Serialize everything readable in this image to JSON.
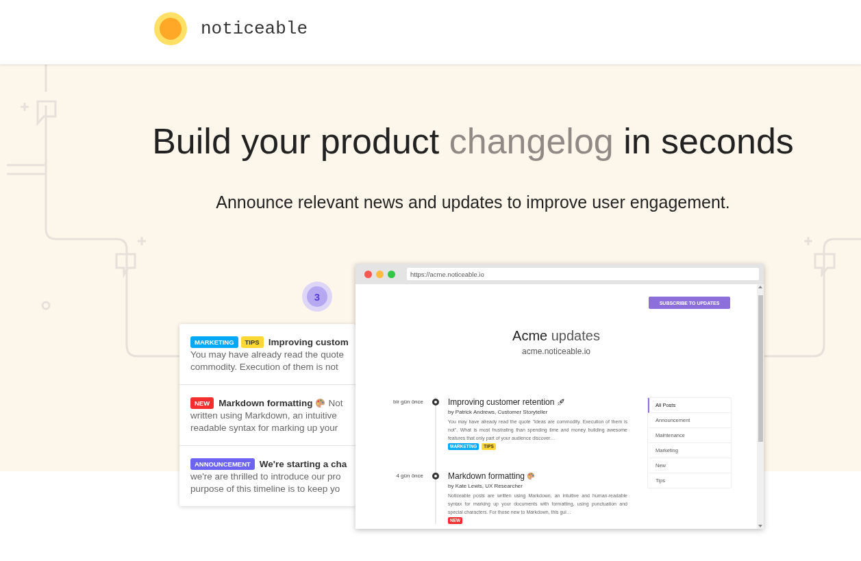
{
  "header": {
    "logo_text": "noticeable"
  },
  "hero": {
    "title_before": "Build your product",
    "title_highlight": "changelog",
    "title_after": "in seconds",
    "subtitle": "Announce relevant news and updates to improve user engagement."
  },
  "widget": {
    "badge_count": "3",
    "items": [
      {
        "tags": [
          {
            "label": "MARKETING",
            "color": "#03a9f4"
          },
          {
            "label": "TIPS",
            "color": "#fdd835"
          }
        ],
        "title": "Improving custom",
        "lines": [
          "You may have already read the quote",
          "commodity. Execution of them is not"
        ]
      },
      {
        "tags": [
          {
            "label": "NEW",
            "color": "#f62d2d"
          }
        ],
        "title": "Markdown formatting",
        "lead": "Not",
        "lines": [
          "written using Markdown, an intuitive",
          "readable syntax for marking up your"
        ]
      },
      {
        "tags": [
          {
            "label": "ANNOUNCEMENT",
            "color": "#6c63f0"
          }
        ],
        "title": "We're starting a cha",
        "lines": [
          "we're are thrilled to introduce our pro",
          "purpose of this timeline is to keep yo"
        ]
      }
    ]
  },
  "browser": {
    "url": "https://acme.noticeable.io",
    "subscribe_label": "SUBSCRIBE TO UPDATES",
    "title_brand": "Acme",
    "title_rest": "updates",
    "domain": "acme.noticeable.io",
    "posts": [
      {
        "date": "bir gün önce",
        "title": "Improving customer retention",
        "author": "by Patrick Andrews, Customer Storyteller",
        "excerpt": "You may have already read the quote \"Ideas are commodity. Execution of them is not\". What is most frustrating than spending time and money building awesome features that only part of your audience discover…",
        "tags": [
          {
            "label": "MARKETING",
            "color": "#03a9f4"
          },
          {
            "label": "TIPS",
            "color": "#fdd835"
          }
        ]
      },
      {
        "date": "4 gün önce",
        "title": "Markdown formatting",
        "author": "by Kate Lewis, UX Researcher",
        "excerpt": "Noticeable posts are written using Markdown, an intuitive and human-readable syntax for marking up your documents with formatting, using punctuation and special characters. For those new to Markdown, this gui…",
        "tags": [
          {
            "label": "NEW",
            "color": "#f62d2d"
          }
        ]
      }
    ],
    "filters": [
      {
        "label": "All Posts",
        "selected": true
      },
      {
        "label": "Announcement",
        "selected": false
      },
      {
        "label": "Maintenance",
        "selected": false
      },
      {
        "label": "Marketing",
        "selected": false
      },
      {
        "label": "New",
        "selected": false
      },
      {
        "label": "Tips",
        "selected": false
      }
    ]
  }
}
